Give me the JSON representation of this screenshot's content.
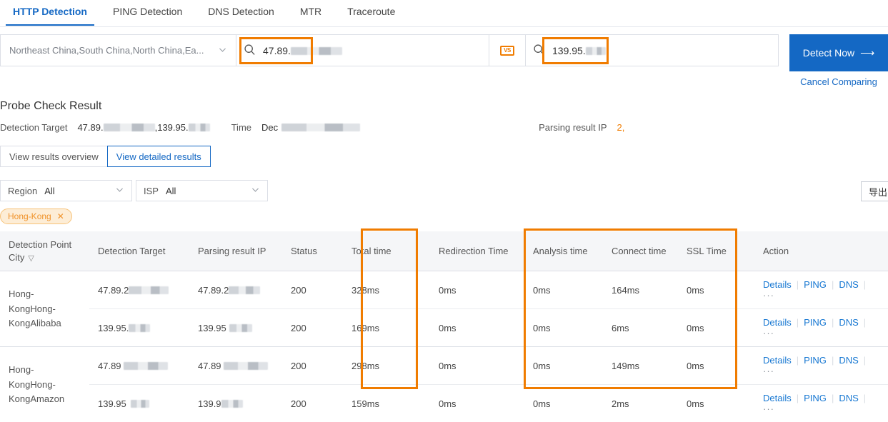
{
  "tabs": [
    {
      "label": "HTTP Detection",
      "active": true
    },
    {
      "label": "PING Detection",
      "active": false
    },
    {
      "label": "DNS Detection",
      "active": false
    },
    {
      "label": "MTR",
      "active": false
    },
    {
      "label": "Traceroute",
      "active": false
    }
  ],
  "search": {
    "region_value": "Northeast China,South China,North China,Ea...",
    "region_chevron": "chevron-down-icon",
    "target1_prefix": "47.89.",
    "target2_prefix": "139.95.",
    "vs_badge": "VS",
    "search_icon": "search-icon",
    "detect_button": "Detect Now",
    "detect_arrow": "⟶",
    "cancel_link": "Cancel Comparing"
  },
  "probe": {
    "title": "Probe Check Result",
    "detection_target_label": "Detection Target",
    "detection_target_value_a": "47.89.",
    "detection_target_sep": ",",
    "detection_target_value_b": "139.95.",
    "time_label": "Time",
    "time_value": "Dec",
    "parsing_label": "Parsing result IP",
    "parsing_value": "2,"
  },
  "viewtabs": [
    {
      "label": "View results overview",
      "active": false
    },
    {
      "label": "View detailed results",
      "active": true
    }
  ],
  "filters": {
    "region_label": "Region",
    "region_value": "All",
    "isp_label": "ISP",
    "isp_value": "All",
    "export_label": "导出",
    "tag_label": "Hong-Kong",
    "tag_close": "✕"
  },
  "table": {
    "columns": [
      {
        "label": "Detection Point City",
        "filter_icon": true
      },
      {
        "label": "Detection Target"
      },
      {
        "label": "Parsing result IP"
      },
      {
        "label": "Status"
      },
      {
        "label": "Total time"
      },
      {
        "label": "Redirection Time"
      },
      {
        "label": "Analysis time"
      },
      {
        "label": "Connect time"
      },
      {
        "label": "SSL Time"
      },
      {
        "label": "Action"
      }
    ],
    "groups": [
      {
        "city": "Hong-KongHong-KongAlibaba",
        "rows": [
          {
            "target": "47.89.2",
            "parsed": "47.89.2",
            "status": "200",
            "total": "328ms",
            "redirect": "0ms",
            "analysis": "0ms",
            "connect": "164ms",
            "ssl": "0ms"
          },
          {
            "target": "139.95.",
            "parsed": "139.95",
            "status": "200",
            "total": "169ms",
            "redirect": "0ms",
            "analysis": "0ms",
            "connect": "6ms",
            "ssl": "0ms"
          }
        ]
      },
      {
        "city": "Hong-KongHong-KongAmazon",
        "rows": [
          {
            "target": "47.89",
            "parsed": "47.89",
            "status": "200",
            "total": "298ms",
            "redirect": "0ms",
            "analysis": "0ms",
            "connect": "149ms",
            "ssl": "0ms"
          },
          {
            "target": "139.95",
            "parsed": "139.9",
            "status": "200",
            "total": "159ms",
            "redirect": "0ms",
            "analysis": "0ms",
            "connect": "2ms",
            "ssl": "0ms"
          }
        ]
      }
    ],
    "actions": {
      "details": "Details",
      "ping": "PING",
      "dns": "DNS",
      "more": "···"
    }
  },
  "colors": {
    "accent_blue": "#1468c4",
    "highlight_orange": "#f07c00",
    "tag_orange": "#f0932b"
  }
}
